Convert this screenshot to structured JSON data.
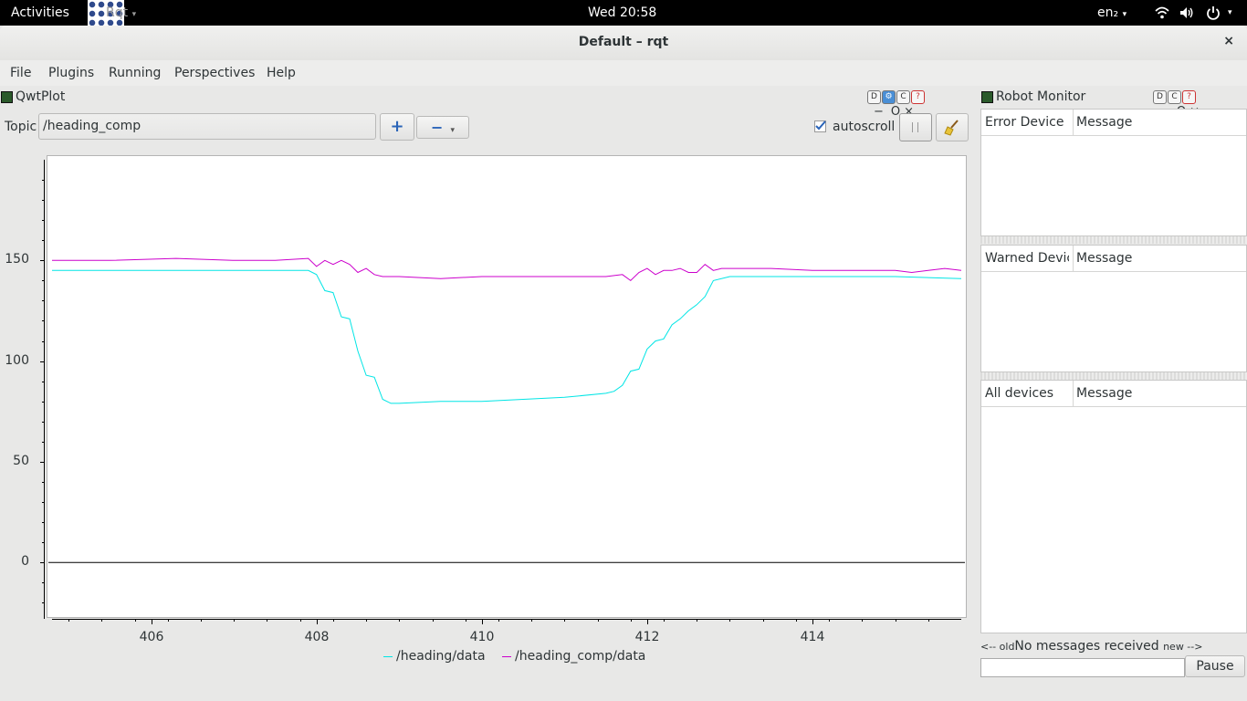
{
  "topbar": {
    "activities": "Activities",
    "app_name": "Rqt",
    "clock": "Wed 20:58",
    "keyboard": "en₂"
  },
  "window": {
    "title": "Default – rqt",
    "close_glyph": "×"
  },
  "menu": [
    {
      "label": "File"
    },
    {
      "label": "Plugins"
    },
    {
      "label": "Running"
    },
    {
      "label": "Perspectives"
    },
    {
      "label": "Help"
    }
  ],
  "qwtplot": {
    "title": "QwtPlot",
    "topic_label": "Topic",
    "topic_value": "/heading_comp",
    "add_glyph": "+",
    "remove_glyph": "−",
    "autoscroll_label": "autoscroll",
    "header_buttons": [
      "D",
      "⚙",
      "C",
      "?"
    ],
    "window_controls": [
      "−",
      "O",
      "×"
    ]
  },
  "chart_data": {
    "type": "line",
    "xlim": [
      404.8,
      415.8
    ],
    "ylim": [
      -28,
      200
    ],
    "xticks": [
      406,
      408,
      410,
      412,
      414
    ],
    "yticks": [
      0,
      50,
      100,
      150
    ],
    "grid": false,
    "legend_position": "bottom",
    "series": [
      {
        "name": "/heading/data",
        "color": "#00e5e5",
        "x": [
          404.8,
          406.0,
          407.0,
          407.5,
          407.9,
          408.0,
          408.1,
          408.2,
          408.3,
          408.4,
          408.5,
          408.6,
          408.7,
          408.8,
          408.9,
          409.0,
          409.5,
          410.0,
          410.5,
          411.0,
          411.5,
          411.6,
          411.7,
          411.8,
          411.9,
          412.0,
          412.1,
          412.2,
          412.3,
          412.4,
          412.5,
          412.6,
          412.7,
          412.8,
          413.0,
          413.5,
          414.0,
          415.0,
          415.8
        ],
        "y": [
          145,
          145,
          145,
          145,
          145,
          143,
          135,
          134,
          122,
          121,
          105,
          93,
          92,
          81,
          79,
          79,
          80,
          80,
          81,
          82,
          84,
          85,
          88,
          95,
          96,
          106,
          110,
          111,
          118,
          121,
          125,
          128,
          132,
          140,
          142,
          142,
          142,
          142,
          141
        ]
      },
      {
        "name": "/heading_comp/data",
        "color": "#cc00cc",
        "x": [
          404.8,
          405.5,
          406.3,
          407.0,
          407.5,
          407.9,
          408.0,
          408.1,
          408.2,
          408.3,
          408.4,
          408.5,
          408.6,
          408.7,
          408.8,
          409.0,
          409.5,
          410.0,
          410.5,
          411.0,
          411.5,
          411.7,
          411.8,
          411.9,
          412.0,
          412.1,
          412.2,
          412.3,
          412.4,
          412.5,
          412.6,
          412.7,
          412.8,
          412.9,
          413.0,
          413.5,
          414.0,
          415.0,
          415.2,
          415.4,
          415.6,
          415.8
        ],
        "y": [
          150,
          150,
          151,
          150,
          150,
          151,
          147,
          150,
          148,
          150,
          148,
          144,
          146,
          143,
          142,
          142,
          141,
          142,
          142,
          142,
          142,
          143,
          140,
          144,
          146,
          143,
          145,
          145,
          146,
          144,
          144,
          148,
          145,
          146,
          146,
          146,
          145,
          145,
          144,
          145,
          146,
          145
        ]
      }
    ]
  },
  "robot_monitor": {
    "title": "Robot Monitor",
    "header_buttons": [
      "D",
      "C",
      "?"
    ],
    "window_controls": [
      "−",
      "O",
      "×"
    ],
    "tables": [
      {
        "col1": "Error Device",
        "col2": "Message"
      },
      {
        "col1": "Warned Device",
        "col2": "Message"
      },
      {
        "col1": "All devices",
        "col2": "Message"
      }
    ],
    "timeline_old": "<-- old",
    "timeline_status": "No messages received",
    "timeline_new": "new -->",
    "pause_label": "Pause"
  }
}
